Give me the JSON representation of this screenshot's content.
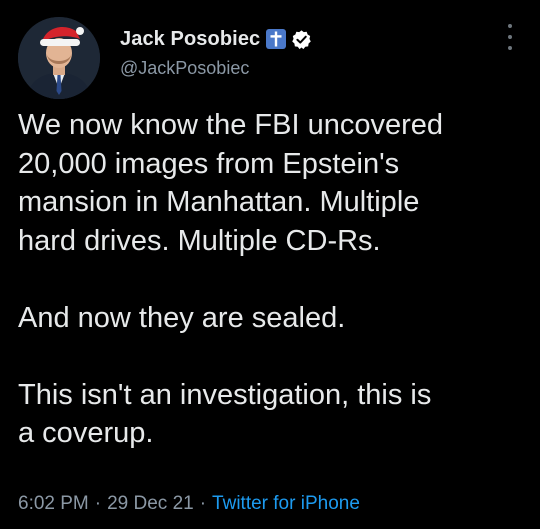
{
  "author": {
    "display_name": "Jack Posobiec",
    "handle": "@JackPosobiec",
    "badges": [
      "cross-badge-icon",
      "verified-icon"
    ]
  },
  "tweet": {
    "paragraphs": [
      "We now know the FBI uncovered\n20,000 images from Epstein's\nmansion in Manhattan. Multiple\nhard drives. Multiple CD-Rs.",
      "And now they are sealed.",
      "This isn't an investigation, this is\na coverup."
    ]
  },
  "meta": {
    "time": "6:02 PM",
    "separator": "·",
    "date": "29 Dec 21",
    "source": "Twitter for iPhone"
  },
  "colors": {
    "background": "#000000",
    "text": "#e7e9ea",
    "secondary_text": "#8b98a5",
    "link": "#1d9bf0",
    "verified": "#ffffff",
    "cross_badge": "#4a78c9"
  },
  "icons": {
    "more": "more-options-icon"
  }
}
